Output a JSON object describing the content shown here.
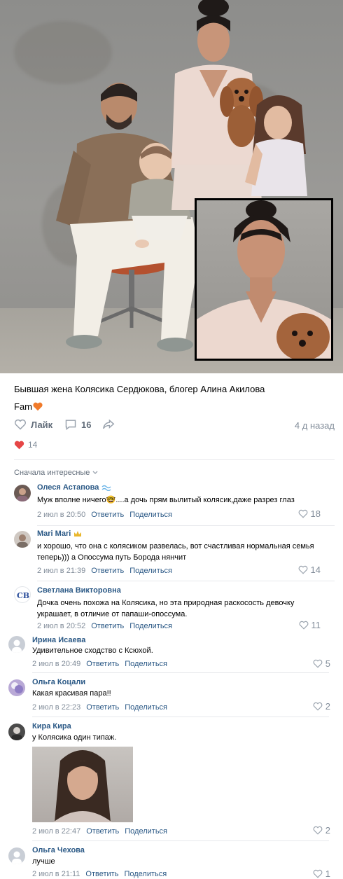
{
  "post": {
    "caption": "Бывшая жена Колясика Сердюкова, блогер Алина Акилова",
    "tag": "Fam",
    "like_label": "Лайк",
    "comments_count": "16",
    "time_ago": "4 д назад",
    "reactions_count": "14"
  },
  "comments_sort": "Сначала интересные",
  "comments": [
    {
      "name": "Олеся Астапова",
      "text": "Муж вполне ничего🤓....а дочь прям вылитый колясик,даже разрез глаз",
      "date": "2 июл в 20:50",
      "reply": "Ответить",
      "share": "Поделиться",
      "likes": "18"
    },
    {
      "name": "Mari Mari",
      "text": "и хорошо, что она с колясиком развелась, вот счастливая нормальная семья теперь))) а Опоссума путь Борода нянчит",
      "date": "2 июл в 21:39",
      "reply": "Ответить",
      "share": "Поделиться",
      "likes": "14"
    },
    {
      "name": "Светлана Викторовна",
      "text": "Дочка очень похожа на Колясика, но эта природная раскосость девочку украшает, в отличие от папаши-опоссума.",
      "date": "2 июл в 20:52",
      "reply": "Ответить",
      "share": "Поделиться",
      "likes": "11"
    },
    {
      "name": "Ирина Исаева",
      "text": "Удивительное сходство с Ксюхой.",
      "date": "2 июл в 20:49",
      "reply": "Ответить",
      "share": "Поделиться",
      "likes": "5"
    },
    {
      "name": "Ольга Коцали",
      "text": "Какая красивая пара!!",
      "date": "2 июл в 22:23",
      "reply": "Ответить",
      "share": "Поделиться",
      "likes": "2"
    },
    {
      "name": "Кира Кира",
      "text": "у Колясика один типаж.",
      "date": "2 июл в 22:47",
      "reply": "Ответить",
      "share": "Поделиться",
      "likes": "2"
    },
    {
      "name": "Ольга Чехова",
      "text": "лучше",
      "date": "2 июл в 21:11",
      "reply": "Ответить",
      "share": "Поделиться",
      "likes": "1"
    }
  ],
  "colors": {
    "link": "#2a5885",
    "muted": "#818c99",
    "heart": "#e64646",
    "icon": "#99a2ad"
  }
}
